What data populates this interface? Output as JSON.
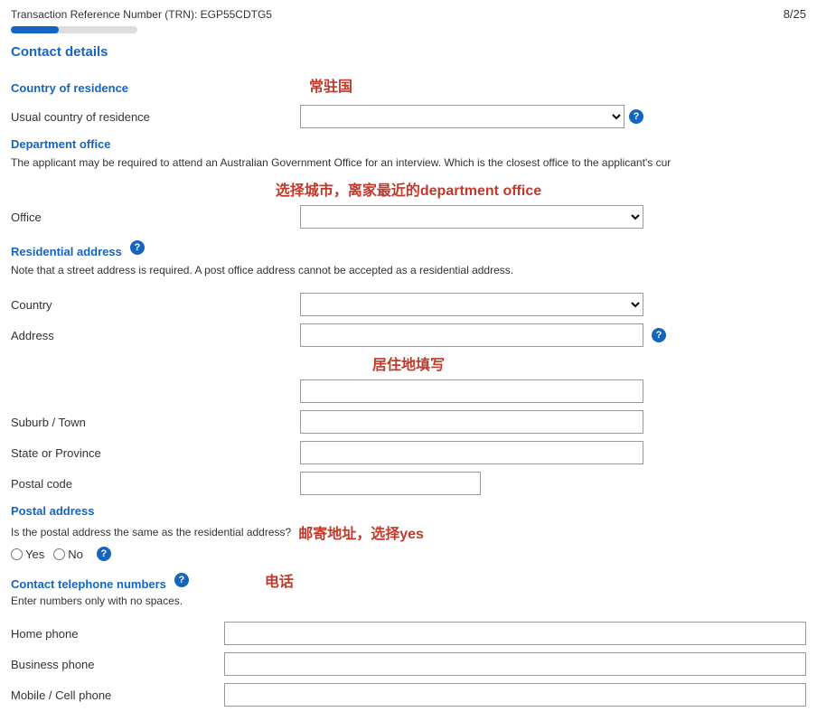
{
  "header": {
    "trn_label": "Transaction Reference Number (TRN): EGP55CDTG5",
    "page_indicator": "8/25",
    "progress_percent": 38
  },
  "contact_details": {
    "title": "Contact details",
    "country_of_residence": {
      "section_title": "Country of residence",
      "annotation": "常驻国",
      "field_label": "Usual country of residence",
      "select_placeholder": ""
    },
    "department_office": {
      "section_title": "Department office",
      "description": "The applicant may be required to attend an Australian Government Office for an interview. Which is the closest office to the applicant's cur",
      "annotation": "选择城市，离家最近的department office",
      "office_label": "Office"
    },
    "residential_address": {
      "section_title": "Residential address",
      "has_help": true,
      "note": "Note that a street address is required. A post office address cannot be accepted as a residential address.",
      "annotation": "居住地填写",
      "country_label": "Country",
      "address_label": "Address",
      "suburb_label": "Suburb / Town",
      "state_label": "State or Province",
      "postal_label": "Postal code"
    },
    "postal_address": {
      "section_title": "Postal address",
      "question": "Is the postal address the same as the residential address?",
      "annotation": "邮寄地址，选择yes",
      "yes_label": "Yes",
      "no_label": "No",
      "has_help": true
    },
    "contact_telephone": {
      "section_title": "Contact telephone numbers",
      "has_help": true,
      "annotation": "电话",
      "instruction": "Enter numbers only with no spaces.",
      "home_phone_label": "Home phone",
      "business_phone_label": "Business phone",
      "mobile_label": "Mobile / Cell phone"
    }
  }
}
